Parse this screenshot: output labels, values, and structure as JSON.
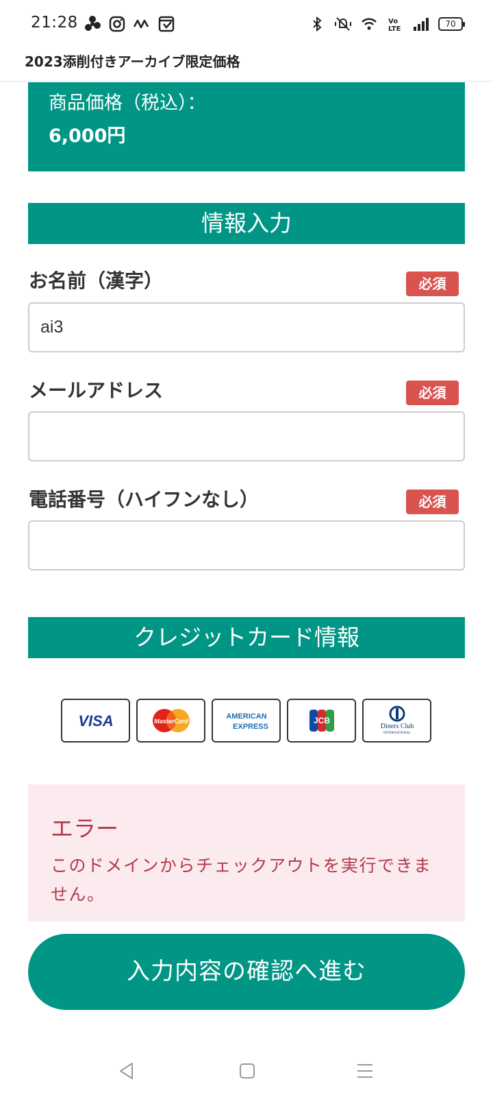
{
  "status": {
    "time": "21:28",
    "battery": "70"
  },
  "header": {
    "title": "2023添削付きアーカイブ限定価格"
  },
  "price": {
    "label": "商品価格（税込）：",
    "value": "6,000円"
  },
  "info_section": {
    "title": "情報入力"
  },
  "form": {
    "required_label": "必須",
    "name_label": "お名前（漢字）",
    "name_value": "ai3",
    "email_label": "メールアドレス",
    "email_value": "",
    "phone_label": "電話番号（ハイフンなし）",
    "phone_value": ""
  },
  "card_section": {
    "title": "クレジットカード情報",
    "cards": [
      "VISA",
      "MasterCard",
      "AMERICAN EXPRESS",
      "JCB",
      "Diners Club INTERNATIONAL"
    ]
  },
  "error": {
    "title": "エラー",
    "message": "このドメインからチェックアウトを実行できません。"
  },
  "submit": {
    "label": "入力内容の確認へ進む"
  },
  "colors": {
    "accent": "#009585",
    "badge": "#d9534f",
    "error_text": "#b03a4c",
    "error_bg": "#fcebee"
  }
}
